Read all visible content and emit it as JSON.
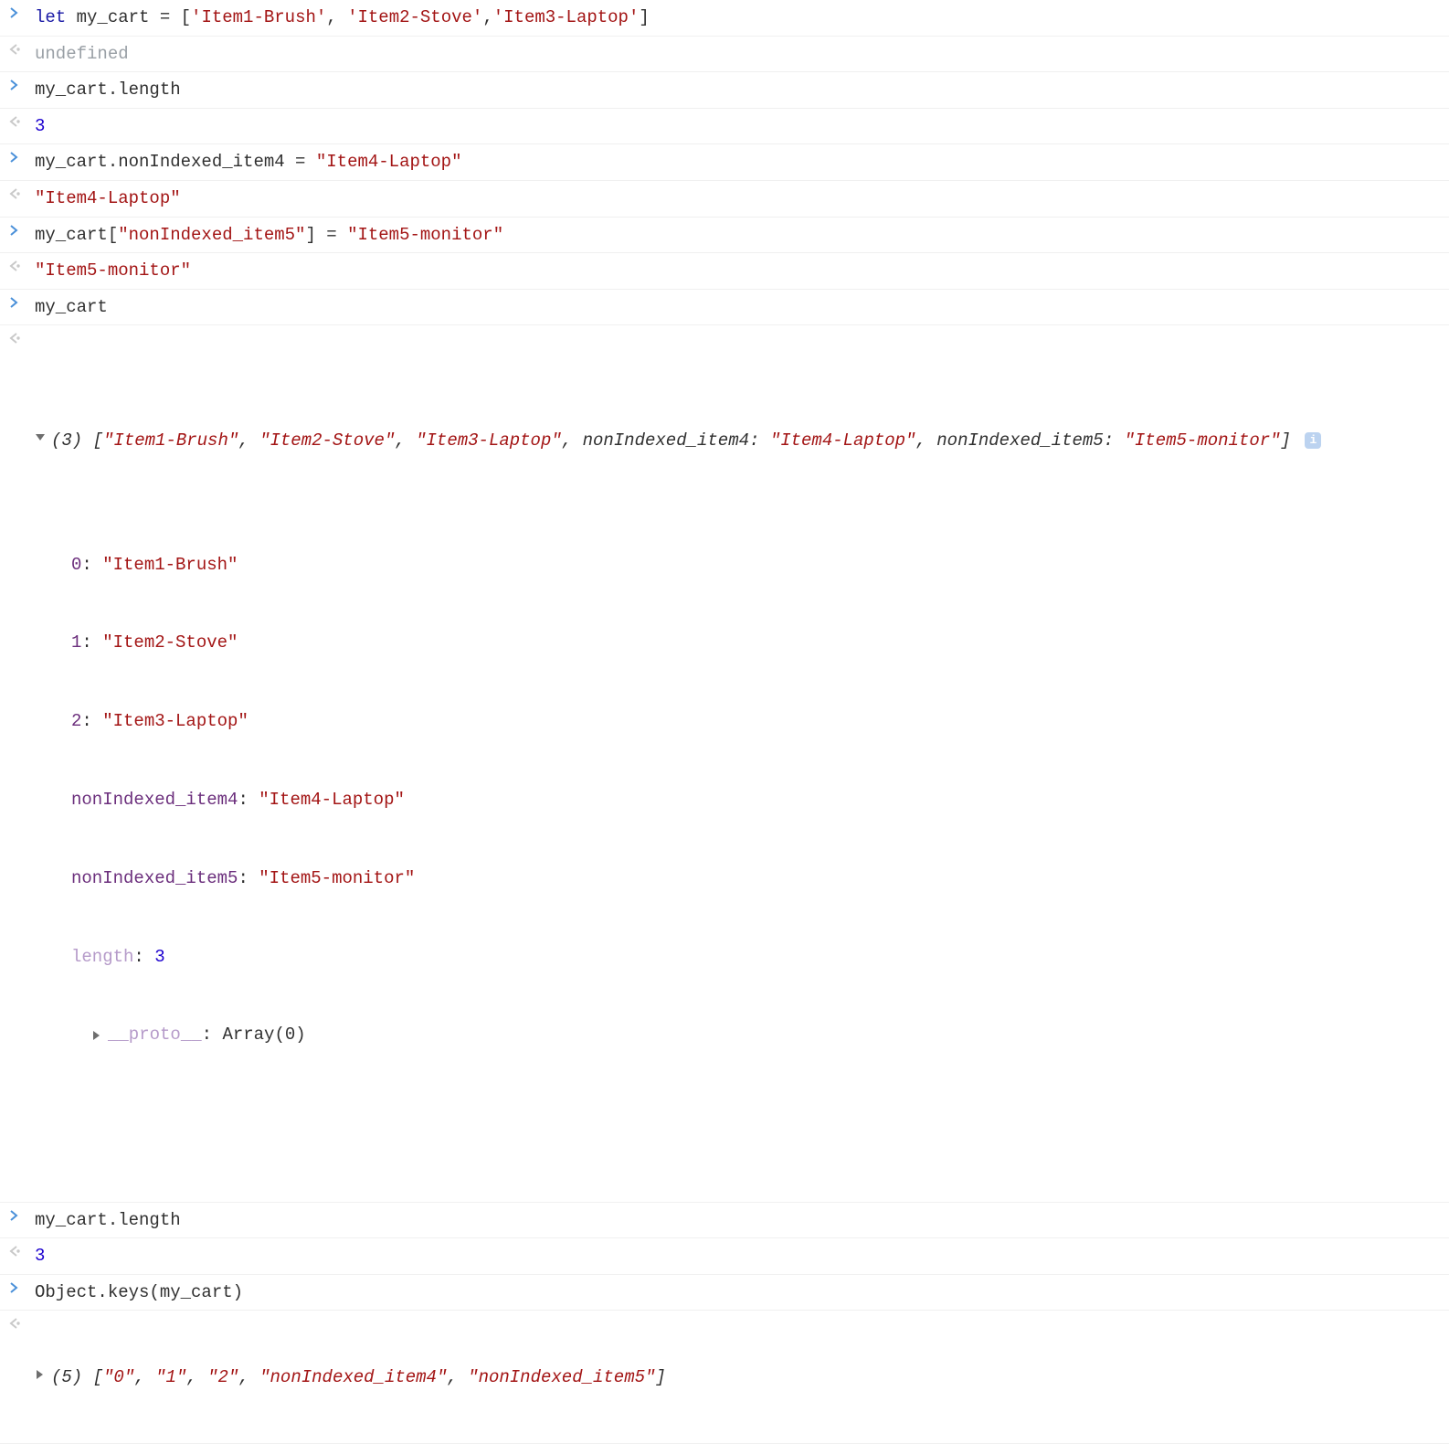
{
  "entry1": {
    "keyword": "let",
    "var": " my_cart = [",
    "s1": "'Item1-Brush'",
    "c1": ", ",
    "s2": "'Item2-Stove'",
    "c2": ",",
    "s3": "'Item3-Laptop'",
    "close": "]"
  },
  "out1": "undefined",
  "entry2": "my_cart.length",
  "out2": "3",
  "entry3": {
    "head": "my_cart.nonIndexed_item4 = ",
    "str": "\"Item4-Laptop\""
  },
  "out3": "\"Item4-Laptop\"",
  "entry4": {
    "head": "my_cart[",
    "key": "\"nonIndexed_item5\"",
    "mid": "] = ",
    "val": "\"Item5-monitor\""
  },
  "out4": "\"Item5-monitor\"",
  "entry5": "my_cart",
  "out5": {
    "count": "(3)",
    "open": " [",
    "s1": "\"Item1-Brush\"",
    "c": ", ",
    "s2": "\"Item2-Stove\"",
    "s3": "\"Item3-Laptop\"",
    "k4": "nonIndexed_item4: ",
    "s4": "\"Item4-Laptop\"",
    "k5": "nonIndexed_item5: ",
    "s5": "\"Item5-monitor\"",
    "close": "]",
    "body": {
      "k0": "0",
      "v0": "\"Item1-Brush\"",
      "k1": "1",
      "v1": "\"Item2-Stove\"",
      "k2": "2",
      "v2": "\"Item3-Laptop\"",
      "k3": "nonIndexed_item4",
      "v3": "\"Item4-Laptop\"",
      "k4": "nonIndexed_item5",
      "v4": "\"Item5-monitor\"",
      "klen": "length",
      "vlen": "3",
      "kproto": "__proto__",
      "vproto": "Array(0)"
    }
  },
  "entry6": "my_cart.length",
  "out6": "3",
  "entry7": "Object.keys(my_cart)",
  "out7": {
    "count": "(5)",
    "open": " [",
    "s1": "\"0\"",
    "c": ", ",
    "s2": "\"1\"",
    "s3": "\"2\"",
    "s4": "\"nonIndexed_item4\"",
    "s5": "\"nonIndexed_item5\"",
    "close": "]"
  },
  "colon": ": "
}
